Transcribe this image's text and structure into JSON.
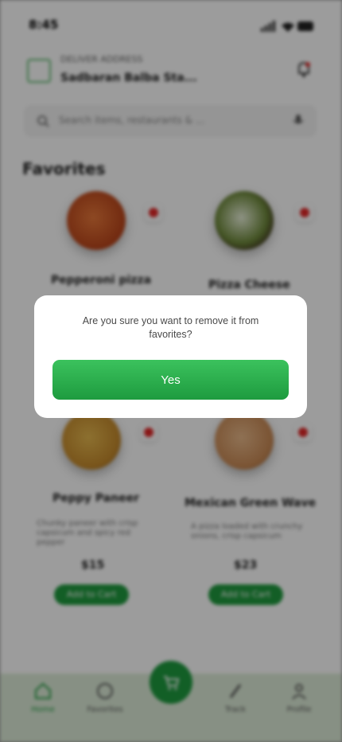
{
  "status_bar": {
    "time": "8:45"
  },
  "header": {
    "deliver_label": "DELIVER ADDRESS",
    "address": "Sadbaran Balba Sta..."
  },
  "search": {
    "placeholder": "Search items, restaurants & ..."
  },
  "section": {
    "title": "Favorites"
  },
  "favorites": [
    {
      "name": "Pepperoni pizza",
      "desc": "",
      "price": "",
      "add_label": ""
    },
    {
      "name": "Pizza Cheese",
      "desc": "",
      "price": "",
      "add_label": ""
    },
    {
      "name": "Peppy Paneer",
      "desc": "Chunky paneer with crisp capsicum and spicy red pepper",
      "price": "$15",
      "add_label": "Add to Cart"
    },
    {
      "name": "Mexican Green Wave",
      "desc": "A pizza loaded with crunchy onions, crisp capsicum",
      "price": "$23",
      "add_label": "Add to Cart"
    }
  ],
  "bottom_nav": {
    "items": [
      {
        "label": "Home"
      },
      {
        "label": "Favorites"
      },
      {
        "label": "Track"
      },
      {
        "label": "Profile"
      }
    ]
  },
  "dialog": {
    "message": "Are you sure you want to remove it from favorites?",
    "confirm_label": "Yes"
  },
  "colors": {
    "accent": "#1e9b3f",
    "heart": "#e12727"
  }
}
